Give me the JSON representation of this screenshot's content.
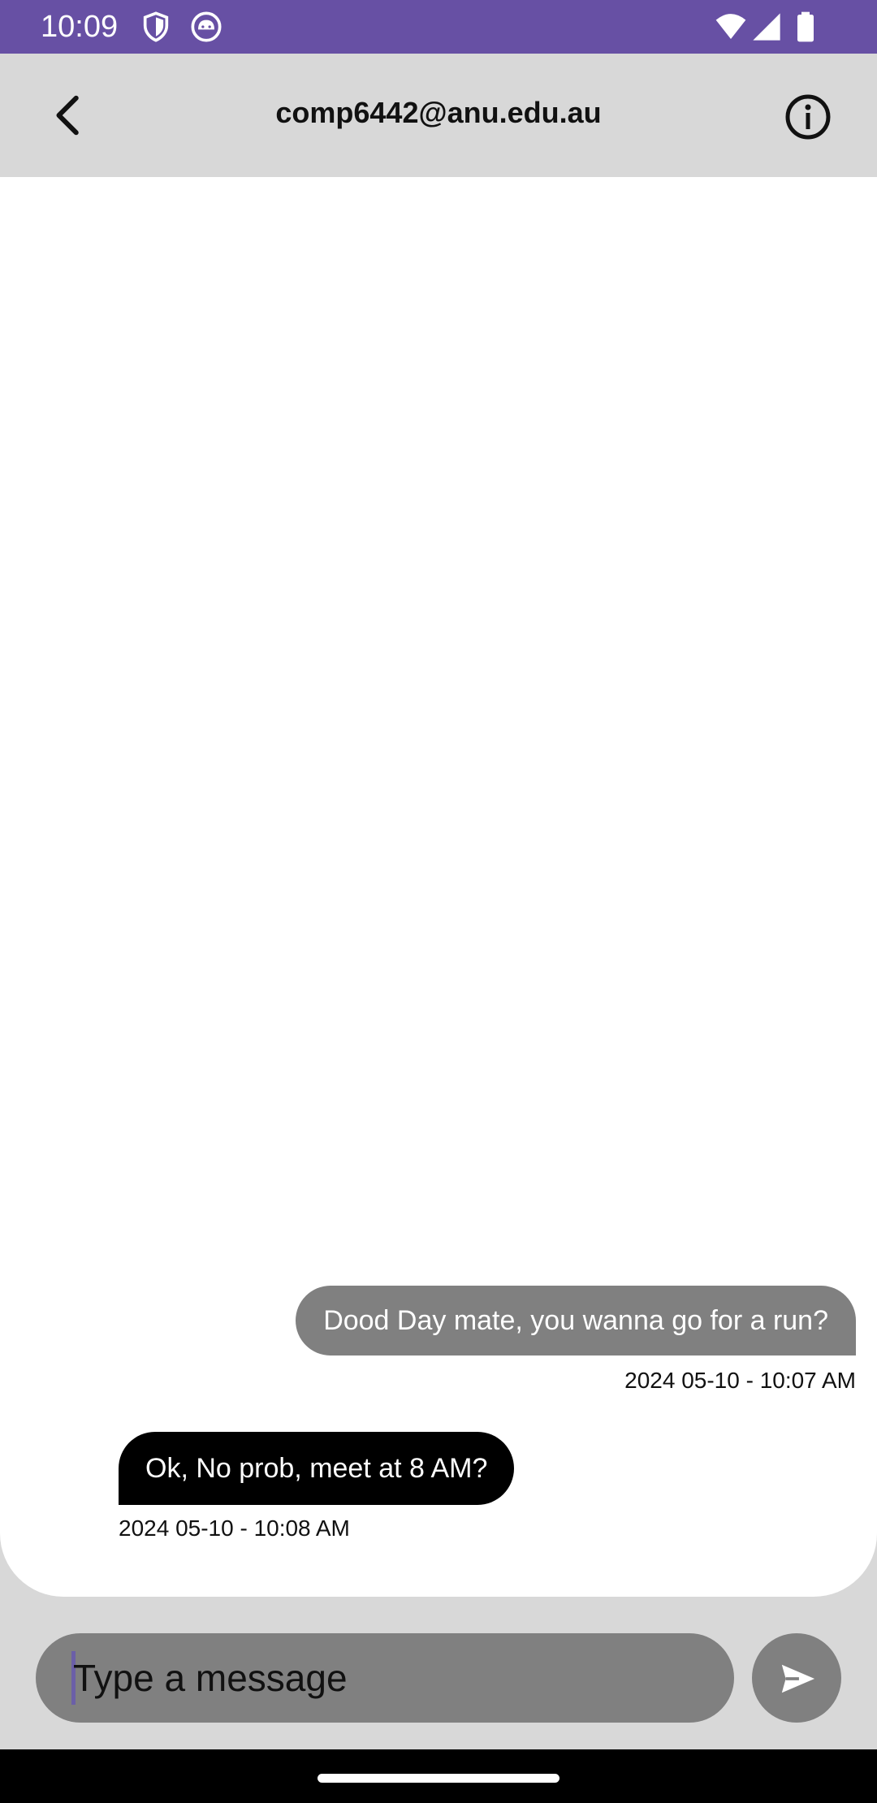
{
  "status_bar": {
    "time": "10:09",
    "color": "#6750a4"
  },
  "app_bar": {
    "title": "comp6442@anu.edu.au",
    "back_icon": "chevron-left-icon",
    "info_icon": "info-circle-icon"
  },
  "messages": [
    {
      "direction": "outgoing",
      "text": "Dood Day mate, you wanna go for a run?",
      "timestamp": "2024 05-10 - 10:07 AM",
      "color": "#808080"
    },
    {
      "direction": "incoming",
      "text": "Ok, No prob, meet at 8 AM?",
      "timestamp": "2024 05-10 - 10:08 AM",
      "color": "#000000"
    }
  ],
  "composer": {
    "placeholder": "Type a message",
    "send_icon": "send-icon"
  }
}
